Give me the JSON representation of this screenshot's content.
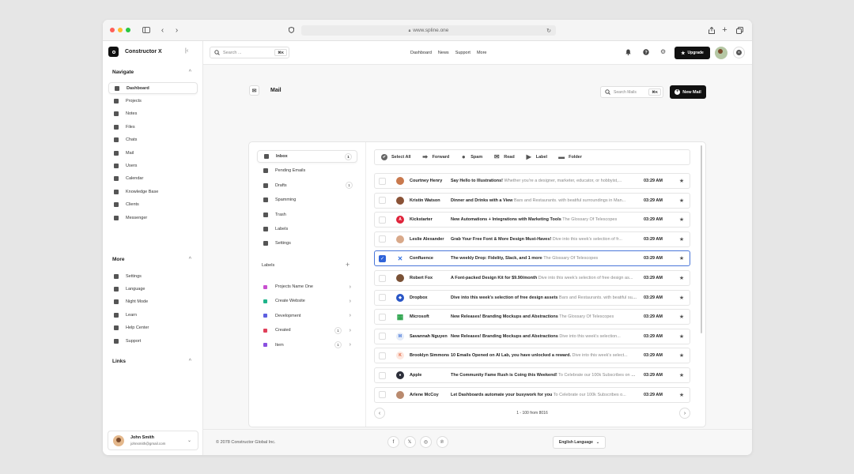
{
  "browser": {
    "url": "www.spline.one"
  },
  "brand": {
    "name": "Constructor X"
  },
  "sidebar": {
    "navigate_title": "Navigate",
    "navigate": [
      {
        "label": "Dashboard",
        "icon": "grid-icon",
        "active": true
      },
      {
        "label": "Projects",
        "icon": "apps-icon"
      },
      {
        "label": "Notes",
        "icon": "folder-icon"
      },
      {
        "label": "Files",
        "icon": "cloud-icon"
      },
      {
        "label": "Chats",
        "icon": "chat-icon"
      },
      {
        "label": "Mail",
        "icon": "mail-icon"
      },
      {
        "label": "Users",
        "icon": "users-icon"
      },
      {
        "label": "Calendar",
        "icon": "calendar-icon"
      },
      {
        "label": "Knowledge Base",
        "icon": "info-icon"
      },
      {
        "label": "Clients",
        "icon": "contacts-icon"
      },
      {
        "label": "Messenger",
        "icon": "messenger-icon"
      }
    ],
    "more_title": "More",
    "more": [
      {
        "label": "Settings",
        "icon": "gear-icon"
      },
      {
        "label": "Language",
        "icon": "globe-icon"
      },
      {
        "label": "Night Mode",
        "icon": "moon-icon"
      },
      {
        "label": "Learn",
        "icon": "graduation-icon"
      },
      {
        "label": "Help Center",
        "icon": "document-icon"
      },
      {
        "label": "Support",
        "icon": "help-icon"
      }
    ],
    "links_title": "Links",
    "user": {
      "name": "John Smith",
      "email": "johnsmith@gmail.com"
    }
  },
  "topbar": {
    "search_placeholder": "Search ...",
    "shortcut": "⌘K",
    "nav": [
      "Dashboard",
      "News",
      "Support",
      "More"
    ],
    "upgrade_label": "Upgrade"
  },
  "mail": {
    "title": "Mail",
    "search_placeholder": "Search Mails",
    "search_shortcut": "⌘K",
    "new_label": "New Mail",
    "folders": [
      {
        "label": "Inbox",
        "count": "1",
        "active": true
      },
      {
        "label": "Pending Emails",
        "count": ""
      },
      {
        "label": "Drafts",
        "count": "1"
      },
      {
        "label": "Spamming",
        "count": ""
      },
      {
        "label": "Trash",
        "count": ""
      },
      {
        "label": "Labels",
        "count": ""
      },
      {
        "label": "Settings",
        "count": ""
      }
    ],
    "labels_title": "Labels",
    "labels": [
      {
        "label": "Projects Name One",
        "color": "#c84fd0",
        "count": ""
      },
      {
        "label": "Create Website",
        "color": "#1fb48a",
        "count": ""
      },
      {
        "label": "Development",
        "color": "#5d5fe0",
        "count": ""
      },
      {
        "label": "Created",
        "color": "#e0405a",
        "count": "1"
      },
      {
        "label": "Item",
        "color": "#8a4fe0",
        "count": "1"
      }
    ],
    "toolbar": [
      "Select All",
      "Forward",
      "Spam",
      "Read",
      "Label",
      "Folder"
    ],
    "rows": [
      {
        "sender": "Courtney Henry",
        "subject": "Say Hello to Illustrations!",
        "preview": "Whether you're a designer, marketer, educator, or hobbyist,...",
        "time": "03:29 AM",
        "avatar": "#c9794d",
        "initial": "",
        "selected": false
      },
      {
        "sender": "Kristin Watson",
        "subject": "Dinner and Drinks with a View",
        "preview": "Bars and Restaurants. with beatiful surroundings in Man...",
        "time": "03:29 AM",
        "avatar": "#8a5236",
        "initial": "",
        "selected": false
      },
      {
        "sender": "Kickstarter",
        "subject": "New Automations + Integrations with Marketing Tools",
        "preview": "The Glossary Of Telescopes",
        "time": "03:29 AM",
        "avatar": "#e0243b",
        "initial": "A",
        "selected": false
      },
      {
        "sender": "Leslie Alexander",
        "subject": "Grab Your Free Font & More Design Must-Haves!",
        "preview": "Dive into this week's selection of fr...",
        "time": "03:29 AM",
        "avatar": "#d9a98a",
        "initial": "",
        "selected": false
      },
      {
        "sender": "Confluence",
        "subject": "The weekly Drop: Fidelity, Slack, and 1 more",
        "preview": "The Glossary Of Telescopes",
        "time": "03:29 AM",
        "avatar": "#2f6fe0",
        "initial": "✕",
        "selected": true
      },
      {
        "sender": "Robert Fox",
        "subject": "A Font-packed Design Kit for $9.90/month",
        "preview": "Dive into this week's selection of free design as...",
        "time": "03:29 AM",
        "avatar": "#7a5136",
        "initial": "",
        "selected": false
      },
      {
        "sender": "Dropbox",
        "subject": "Dive into this week's selection of free design assets",
        "preview": "Bars and Restaurants. with beatiful surr...",
        "time": "03:29 AM",
        "avatar": "#2a56c6",
        "initial": "◆",
        "selected": false
      },
      {
        "sender": "Microsoft",
        "subject": "New Releases! Branding Mockups and Abstractions",
        "preview": "The Glossary Of Telescopes",
        "time": "03:29 AM",
        "avatar": "#f25022",
        "initial": "▦",
        "selected": false
      },
      {
        "sender": "Savannah Nguyen",
        "subject": "New Releases! Branding Mockups and Abstractions",
        "preview": "Dive into this week's selection...",
        "time": "03:29 AM",
        "avatar": "#e5ecf8",
        "initial": "M",
        "selected": false
      },
      {
        "sender": "Brooklyn Simmons",
        "subject": "10 Emails Opened on AI Lab, you have unlocked a reward.",
        "preview": "Dive into this week's select...",
        "time": "03:29 AM",
        "avatar": "#fde7df",
        "initial": "K",
        "selected": false
      },
      {
        "sender": "Apple",
        "subject": "The Community Fame Rush is Coing this Weekend!",
        "preview": "To Celebrate our 100k Subscribes on Reddit",
        "time": "03:29 AM",
        "avatar": "#2c2f3a",
        "initial": "●",
        "selected": false
      },
      {
        "sender": "Arlene McCoy",
        "subject": "Let Dashboards automate your busywork for you",
        "preview": "To Celebrate our 100k Subscribes o...",
        "time": "03:29 AM",
        "avatar": "#b98a6e",
        "initial": "",
        "selected": false
      }
    ],
    "pager": "1 - 100 from 8016"
  },
  "footer": {
    "copyright": "© 2078 Constructor Global Inc.",
    "social": [
      "f",
      "𝕏",
      "◎",
      "℗"
    ],
    "language": "English Language"
  }
}
